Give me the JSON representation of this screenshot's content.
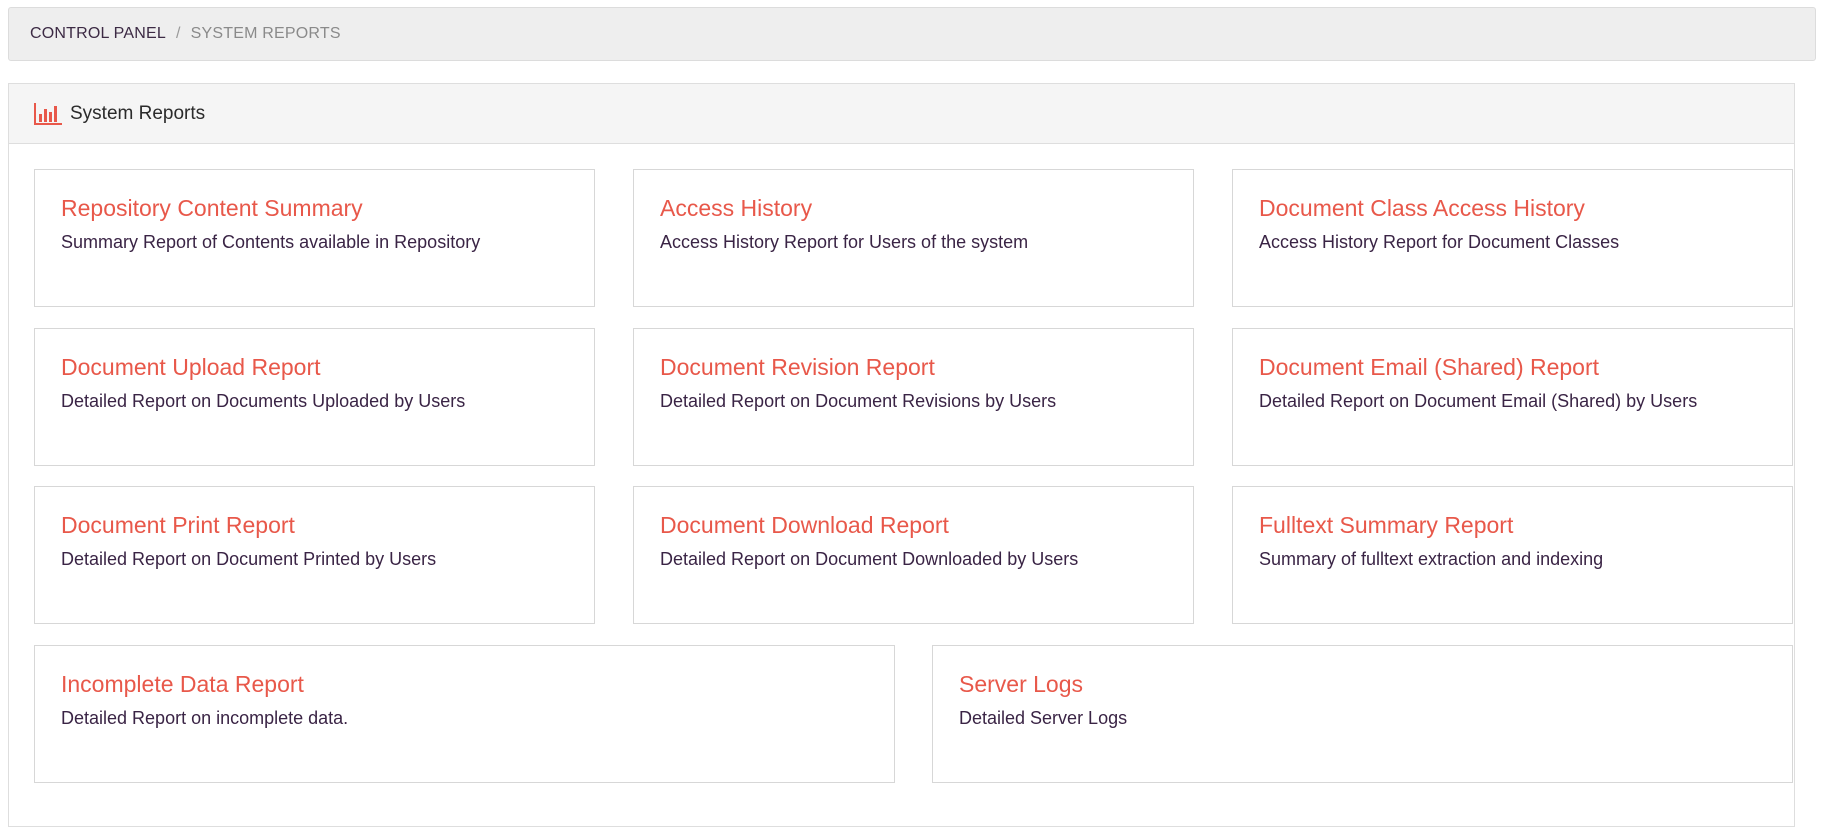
{
  "breadcrumb": {
    "items": [
      {
        "label": "CONTROL PANEL"
      },
      {
        "label": "SYSTEM REPORTS"
      }
    ],
    "separator": "/"
  },
  "panel": {
    "title": "System Reports",
    "icon": "bar-chart-icon",
    "accent_color": "#e8584a"
  },
  "reports": [
    {
      "title": "Repository Content Summary",
      "description": "Summary Report of Contents available in Repository"
    },
    {
      "title": "Access History",
      "description": "Access History Report for Users of the system"
    },
    {
      "title": "Document Class Access History",
      "description": "Access History Report for Document Classes"
    },
    {
      "title": "Document Upload Report",
      "description": "Detailed Report on Documents Uploaded by Users"
    },
    {
      "title": "Document Revision Report",
      "description": "Detailed Report on Document Revisions by Users"
    },
    {
      "title": "Document Email (Shared) Report",
      "description": "Detailed Report on Document Email (Shared) by Users"
    },
    {
      "title": "Document Print Report",
      "description": "Detailed Report on Document Printed by Users"
    },
    {
      "title": "Document Download Report",
      "description": "Detailed Report on Document Downloaded by Users"
    },
    {
      "title": "Fulltext Summary Report",
      "description": "Summary of fulltext extraction and indexing"
    },
    {
      "title": "Incomplete Data Report",
      "description": "Detailed Report on incomplete data."
    },
    {
      "title": "Server Logs",
      "description": "Detailed Server Logs"
    }
  ]
}
